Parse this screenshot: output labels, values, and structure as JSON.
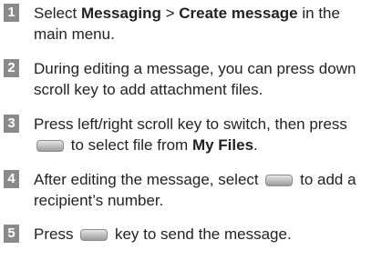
{
  "steps": [
    {
      "number": "1",
      "line1_pre": "Select ",
      "line1_bold1": "Messaging",
      "line1_sep": " > ",
      "line1_bold2": "Create message",
      "line1_post": " in the",
      "line2": "main menu."
    },
    {
      "number": "2",
      "line1": "During editing a message, you can press down",
      "line2": "scroll key to add attachment files."
    },
    {
      "number": "3",
      "line1": "Press left/right scroll key to switch, then press",
      "line2_pre": "to select file from ",
      "line2_bold": "My Files",
      "line2_post": "."
    },
    {
      "number": "4",
      "line1_pre": "After editing the message, select",
      "line1_post": "to add a",
      "line2": "recipient’s number."
    },
    {
      "number": "5",
      "line1_pre": "Press",
      "line1_post": "key to send the message."
    }
  ],
  "icons": {
    "soft_key": "soft-key-icon"
  },
  "colors": {
    "number_badge": "#8a8a8a",
    "text": "#222222"
  }
}
